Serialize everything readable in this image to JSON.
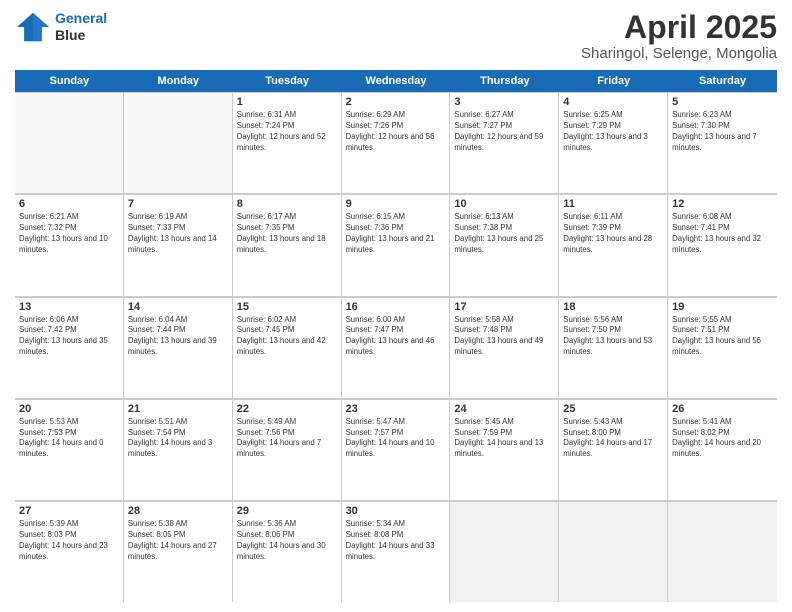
{
  "header": {
    "logo_line1": "General",
    "logo_line2": "Blue",
    "title": "April 2025",
    "subtitle": "Sharingol, Selenge, Mongolia"
  },
  "weekdays": [
    "Sunday",
    "Monday",
    "Tuesday",
    "Wednesday",
    "Thursday",
    "Friday",
    "Saturday"
  ],
  "rows": [
    [
      {
        "day": "",
        "empty": true
      },
      {
        "day": "",
        "empty": true
      },
      {
        "day": "1",
        "sunrise": "Sunrise: 6:31 AM",
        "sunset": "Sunset: 7:24 PM",
        "daylight": "Daylight: 12 hours and 52 minutes."
      },
      {
        "day": "2",
        "sunrise": "Sunrise: 6:29 AM",
        "sunset": "Sunset: 7:26 PM",
        "daylight": "Daylight: 12 hours and 56 minutes."
      },
      {
        "day": "3",
        "sunrise": "Sunrise: 6:27 AM",
        "sunset": "Sunset: 7:27 PM",
        "daylight": "Daylight: 12 hours and 59 minutes."
      },
      {
        "day": "4",
        "sunrise": "Sunrise: 6:25 AM",
        "sunset": "Sunset: 7:29 PM",
        "daylight": "Daylight: 13 hours and 3 minutes."
      },
      {
        "day": "5",
        "sunrise": "Sunrise: 6:23 AM",
        "sunset": "Sunset: 7:30 PM",
        "daylight": "Daylight: 13 hours and 7 minutes."
      }
    ],
    [
      {
        "day": "6",
        "sunrise": "Sunrise: 6:21 AM",
        "sunset": "Sunset: 7:32 PM",
        "daylight": "Daylight: 13 hours and 10 minutes."
      },
      {
        "day": "7",
        "sunrise": "Sunrise: 6:19 AM",
        "sunset": "Sunset: 7:33 PM",
        "daylight": "Daylight: 13 hours and 14 minutes."
      },
      {
        "day": "8",
        "sunrise": "Sunrise: 6:17 AM",
        "sunset": "Sunset: 7:35 PM",
        "daylight": "Daylight: 13 hours and 18 minutes."
      },
      {
        "day": "9",
        "sunrise": "Sunrise: 6:15 AM",
        "sunset": "Sunset: 7:36 PM",
        "daylight": "Daylight: 13 hours and 21 minutes."
      },
      {
        "day": "10",
        "sunrise": "Sunrise: 6:13 AM",
        "sunset": "Sunset: 7:38 PM",
        "daylight": "Daylight: 13 hours and 25 minutes."
      },
      {
        "day": "11",
        "sunrise": "Sunrise: 6:11 AM",
        "sunset": "Sunset: 7:39 PM",
        "daylight": "Daylight: 13 hours and 28 minutes."
      },
      {
        "day": "12",
        "sunrise": "Sunrise: 6:08 AM",
        "sunset": "Sunset: 7:41 PM",
        "daylight": "Daylight: 13 hours and 32 minutes."
      }
    ],
    [
      {
        "day": "13",
        "sunrise": "Sunrise: 6:06 AM",
        "sunset": "Sunset: 7:42 PM",
        "daylight": "Daylight: 13 hours and 35 minutes."
      },
      {
        "day": "14",
        "sunrise": "Sunrise: 6:04 AM",
        "sunset": "Sunset: 7:44 PM",
        "daylight": "Daylight: 13 hours and 39 minutes."
      },
      {
        "day": "15",
        "sunrise": "Sunrise: 6:02 AM",
        "sunset": "Sunset: 7:45 PM",
        "daylight": "Daylight: 13 hours and 42 minutes."
      },
      {
        "day": "16",
        "sunrise": "Sunrise: 6:00 AM",
        "sunset": "Sunset: 7:47 PM",
        "daylight": "Daylight: 13 hours and 46 minutes."
      },
      {
        "day": "17",
        "sunrise": "Sunrise: 5:58 AM",
        "sunset": "Sunset: 7:48 PM",
        "daylight": "Daylight: 13 hours and 49 minutes."
      },
      {
        "day": "18",
        "sunrise": "Sunrise: 5:56 AM",
        "sunset": "Sunset: 7:50 PM",
        "daylight": "Daylight: 13 hours and 53 minutes."
      },
      {
        "day": "19",
        "sunrise": "Sunrise: 5:55 AM",
        "sunset": "Sunset: 7:51 PM",
        "daylight": "Daylight: 13 hours and 56 minutes."
      }
    ],
    [
      {
        "day": "20",
        "sunrise": "Sunrise: 5:53 AM",
        "sunset": "Sunset: 7:53 PM",
        "daylight": "Daylight: 14 hours and 0 minutes."
      },
      {
        "day": "21",
        "sunrise": "Sunrise: 5:51 AM",
        "sunset": "Sunset: 7:54 PM",
        "daylight": "Daylight: 14 hours and 3 minutes."
      },
      {
        "day": "22",
        "sunrise": "Sunrise: 5:49 AM",
        "sunset": "Sunset: 7:56 PM",
        "daylight": "Daylight: 14 hours and 7 minutes."
      },
      {
        "day": "23",
        "sunrise": "Sunrise: 5:47 AM",
        "sunset": "Sunset: 7:57 PM",
        "daylight": "Daylight: 14 hours and 10 minutes."
      },
      {
        "day": "24",
        "sunrise": "Sunrise: 5:45 AM",
        "sunset": "Sunset: 7:59 PM",
        "daylight": "Daylight: 14 hours and 13 minutes."
      },
      {
        "day": "25",
        "sunrise": "Sunrise: 5:43 AM",
        "sunset": "Sunset: 8:00 PM",
        "daylight": "Daylight: 14 hours and 17 minutes."
      },
      {
        "day": "26",
        "sunrise": "Sunrise: 5:41 AM",
        "sunset": "Sunset: 8:02 PM",
        "daylight": "Daylight: 14 hours and 20 minutes."
      }
    ],
    [
      {
        "day": "27",
        "sunrise": "Sunrise: 5:39 AM",
        "sunset": "Sunset: 8:03 PM",
        "daylight": "Daylight: 14 hours and 23 minutes."
      },
      {
        "day": "28",
        "sunrise": "Sunrise: 5:38 AM",
        "sunset": "Sunset: 8:05 PM",
        "daylight": "Daylight: 14 hours and 27 minutes."
      },
      {
        "day": "29",
        "sunrise": "Sunrise: 5:36 AM",
        "sunset": "Sunset: 8:06 PM",
        "daylight": "Daylight: 14 hours and 30 minutes."
      },
      {
        "day": "30",
        "sunrise": "Sunrise: 5:34 AM",
        "sunset": "Sunset: 8:08 PM",
        "daylight": "Daylight: 14 hours and 33 minutes."
      },
      {
        "day": "",
        "empty": true
      },
      {
        "day": "",
        "empty": true
      },
      {
        "day": "",
        "empty": true
      }
    ]
  ]
}
